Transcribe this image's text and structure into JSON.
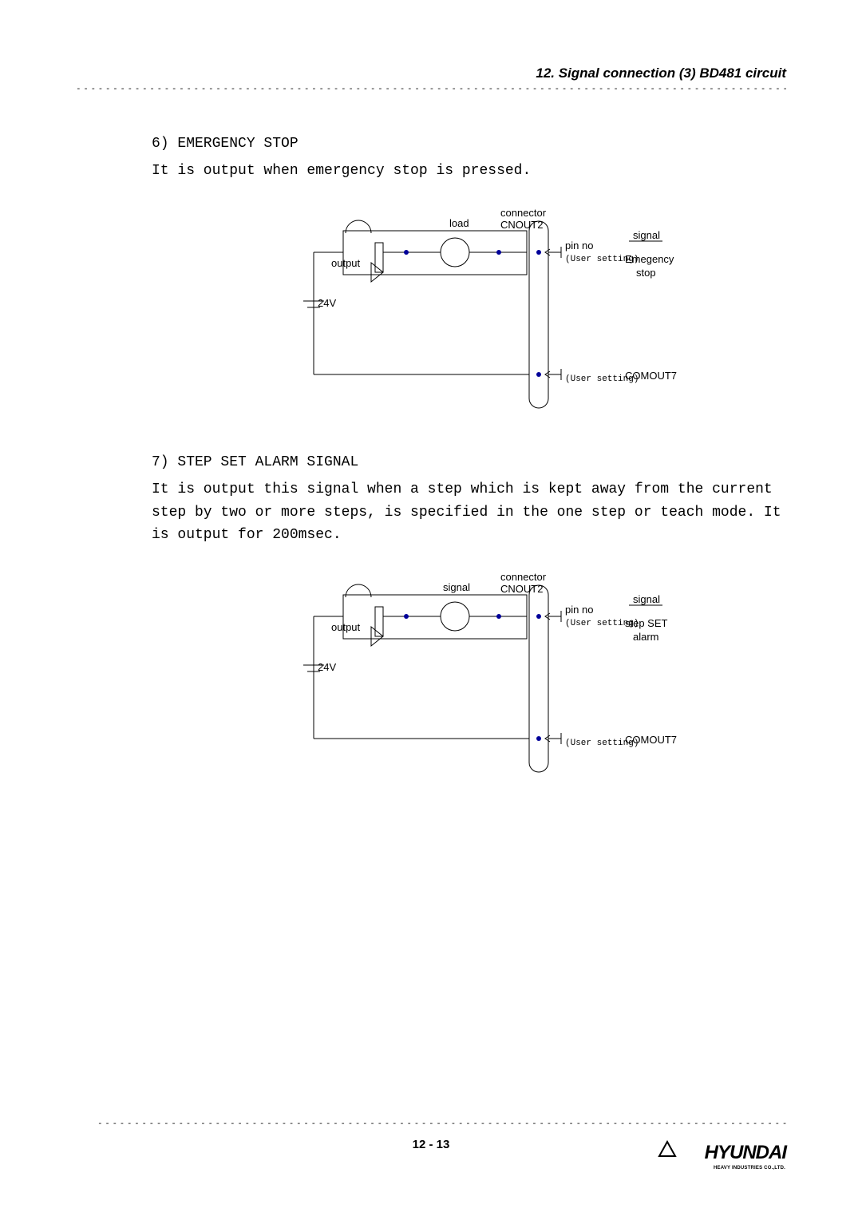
{
  "header": {
    "title": "12. Signal connection (3) BD481 circuit"
  },
  "section6": {
    "title": "6) EMERGENCY STOP",
    "text": "It is output when emergency stop is pressed.",
    "diagram": {
      "output": "output",
      "voltage": "24V",
      "load": "load",
      "connector": "connector",
      "connector_name": "CNOUT2",
      "pin_no": "pin no",
      "user_setting": "(User setting)",
      "signal_label": "signal",
      "signal1": "Emegency",
      "signal2": "stop",
      "comout": "COMOUT7"
    }
  },
  "section7": {
    "title": "7) STEP SET ALARM SIGNAL",
    "text": "It is output this signal when a step which is kept away from the current step by two or more steps, is specified in the one step or teach mode. It is output for 200msec.",
    "diagram": {
      "output": "output",
      "voltage": "24V",
      "signal_left": "signal",
      "connector": "connector",
      "connector_name": "CNOUT2",
      "pin_no": "pin no",
      "user_setting": "(User setting)",
      "signal_label": "signal",
      "signal1": "step SET",
      "signal2": "alarm",
      "comout": "COMOUT7"
    }
  },
  "footer": {
    "page": "12 - 13",
    "logo": "HYUNDAI",
    "logo_sub": "HEAVY INDUSTRIES CO.,LTD."
  }
}
